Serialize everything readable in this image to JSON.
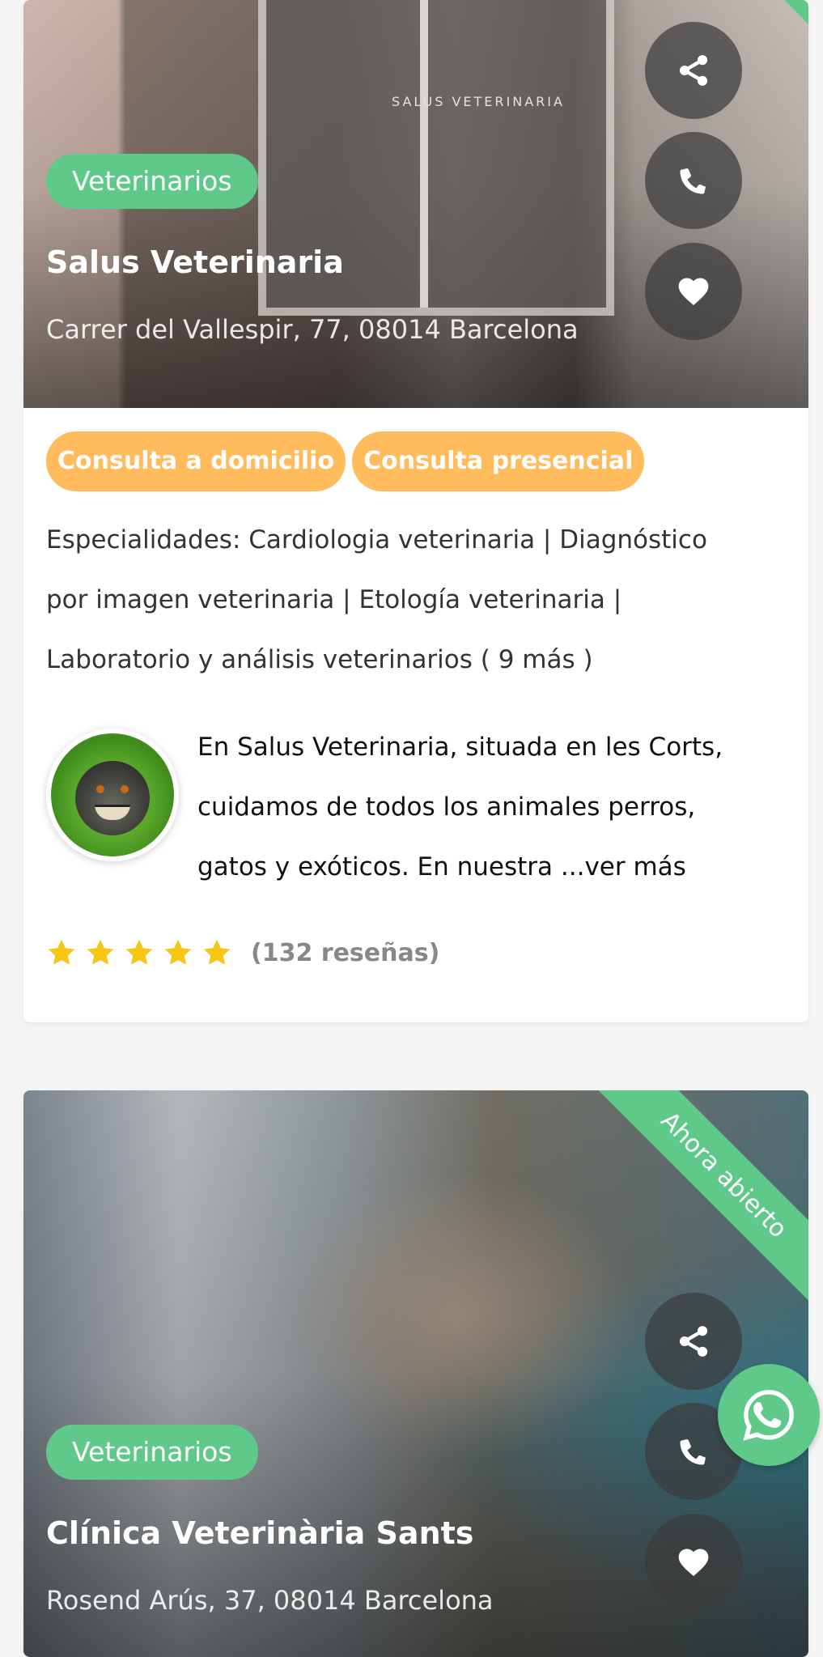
{
  "listings": [
    {
      "category": "Veterinarios",
      "name": "Salus Veterinaria",
      "address": "Carrer del Vallespir, 77, 08014 Barcelona",
      "door_sign": "SALUS VETERINARIA",
      "tags": [
        "Consulta a domicilio",
        "Consulta presencial"
      ],
      "specialties_line1": "Especialidades: Cardiologia veterinaria | Diagnóstico",
      "specialties_line2": "por imagen veterinaria | Etología veterinaria |",
      "specialties_line3": "Laboratorio y análisis veterinarios ( 9 más )",
      "description_line1": "En Salus Veterinaria,  situada en les Corts,",
      "description_line2": "cuidamos de todos los animales perros,",
      "description_line3": "gatos y exóticos. En nuestra ",
      "more_label": "...ver más",
      "rating_stars": 5,
      "reviews_label": "(132 reseñas)"
    },
    {
      "category": "Veterinarios",
      "name": "Clínica Veterinària Sants",
      "address": "Rosend Arús, 37, 08014 Barcelona",
      "open_ribbon": "Ahora abierto"
    }
  ],
  "icons": {
    "share": "share-icon",
    "phone": "phone-icon",
    "favorite": "heart-icon",
    "whatsapp": "whatsapp-icon",
    "star": "star-icon"
  },
  "colors": {
    "category_badge": "#5fc98a",
    "tag": "#ffbb5c",
    "star": "#f5c518",
    "whatsapp": "#5fc98a"
  }
}
